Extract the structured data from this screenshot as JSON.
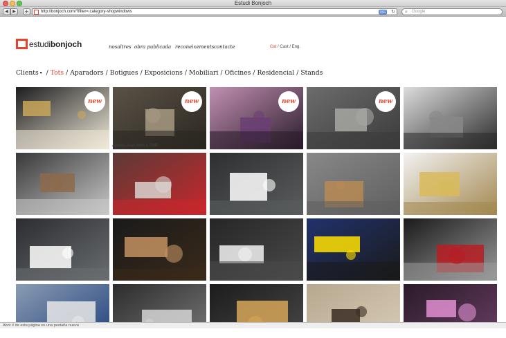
{
  "browser": {
    "window_title": "Estudi Bonjoch",
    "url": "http://bonjoch.com/?filter=.category-shopwindows",
    "search_placeholder": "Google",
    "rss_label": "RSS"
  },
  "site": {
    "logo_regular": "estudi",
    "logo_bold": "bonjoch",
    "nav": [
      "nosaltres",
      "obra publicada",
      "reconeixements",
      "contacte"
    ],
    "languages": [
      {
        "label": "Cat",
        "active": true
      },
      {
        "label": "Cast",
        "active": false
      },
      {
        "label": "Eng",
        "active": false
      }
    ],
    "lang_separator": " / "
  },
  "filters": {
    "clients_label": "Clients",
    "clients_caret": "▾",
    "items": [
      "Tots",
      "Aparadors",
      "Botigues",
      "Exposicions",
      "Mobiliari",
      "Oficines",
      "Residencial",
      "Stands"
    ],
    "active": "Tots",
    "separator": "/"
  },
  "badge_text": "new",
  "caption_text": "Apunts Joan Miró a TMB",
  "tiles": [
    {
      "name": "shop-window-white-mannequins",
      "badge": true,
      "colors": [
        "#1d1d1f",
        "#c9a75a",
        "#f1ead9"
      ]
    },
    {
      "name": "apunts-joan-miro-tmb",
      "badge": true,
      "colors": [
        "#5a5246",
        "#a79a82",
        "#2a2620"
      ]
    },
    {
      "name": "pink-exhibition-space",
      "badge": true,
      "colors": [
        "#c18fb2",
        "#6a3e74",
        "#2a1c2a"
      ]
    },
    {
      "name": "sand-installation",
      "badge": true,
      "colors": [
        "#6c6c6c",
        "#a7a7a3",
        "#3a3a3a"
      ]
    },
    {
      "name": "converse-shelf-display",
      "badge": false,
      "colors": [
        "#dcdcdc",
        "#888888",
        "#2b2b2b"
      ]
    },
    {
      "name": "converse-sneaker-vitrine",
      "badge": false,
      "colors": [
        "#383838",
        "#8c6a4a",
        "#c8c8c8"
      ]
    },
    {
      "name": "converse-window-star",
      "badge": false,
      "colors": [
        "#5b3a36",
        "#d9d3cf",
        "#c8272c"
      ]
    },
    {
      "name": "white-desk-laptop",
      "badge": false,
      "colors": [
        "#2d2f30",
        "#ffffff",
        "#5a5c5d"
      ]
    },
    {
      "name": "wooden-shelves-concrete",
      "badge": false,
      "colors": [
        "#888888",
        "#b98b55",
        "#5f5f5f"
      ]
    },
    {
      "name": "yellow-wood-cabinet",
      "badge": false,
      "colors": [
        "#f2f2f2",
        "#d9ba5a",
        "#a38850"
      ]
    },
    {
      "name": "empty-office-tables",
      "badge": false,
      "colors": [
        "#2b2d30",
        "#ffffff",
        "#6a6d70"
      ]
    },
    {
      "name": "wooden-bench",
      "badge": false,
      "colors": [
        "#1a1a1a",
        "#c39262",
        "#3a2a1a"
      ]
    },
    {
      "name": "white-sofa",
      "badge": false,
      "colors": [
        "#262626",
        "#f2f2f2",
        "#4a4a4a"
      ]
    },
    {
      "name": "blue-yellow-silhouettes",
      "badge": false,
      "colors": [
        "#21326c",
        "#ffe200",
        "#1a1a1a"
      ]
    },
    {
      "name": "red-carpet-exhibition",
      "badge": false,
      "colors": [
        "#1a1a1a",
        "#b81d23",
        "#9a9a9a"
      ]
    },
    {
      "name": "universitat-abat-oliba",
      "badge": false,
      "colors": [
        "#8a9cb3",
        "#e7e7e7",
        "#1f3f7b"
      ]
    },
    {
      "name": "striped-wall",
      "badge": false,
      "colors": [
        "#2c2c2c",
        "#d5d5d5",
        "#7a7a7a"
      ]
    },
    {
      "name": "bar-counter-lights",
      "badge": false,
      "colors": [
        "#1c1c1c",
        "#d7a658",
        "#4a4a4a"
      ]
    },
    {
      "name": "gallery-visitors",
      "badge": false,
      "colors": [
        "#b7a78f",
        "#3a2c22",
        "#d9cdb8"
      ]
    },
    {
      "name": "pink-mannequin-window",
      "badge": false,
      "colors": [
        "#2a1a28",
        "#e08fd0",
        "#6b3f66"
      ]
    }
  ],
  "status_text": "Abrir # de esta página en una pestaña nueva"
}
